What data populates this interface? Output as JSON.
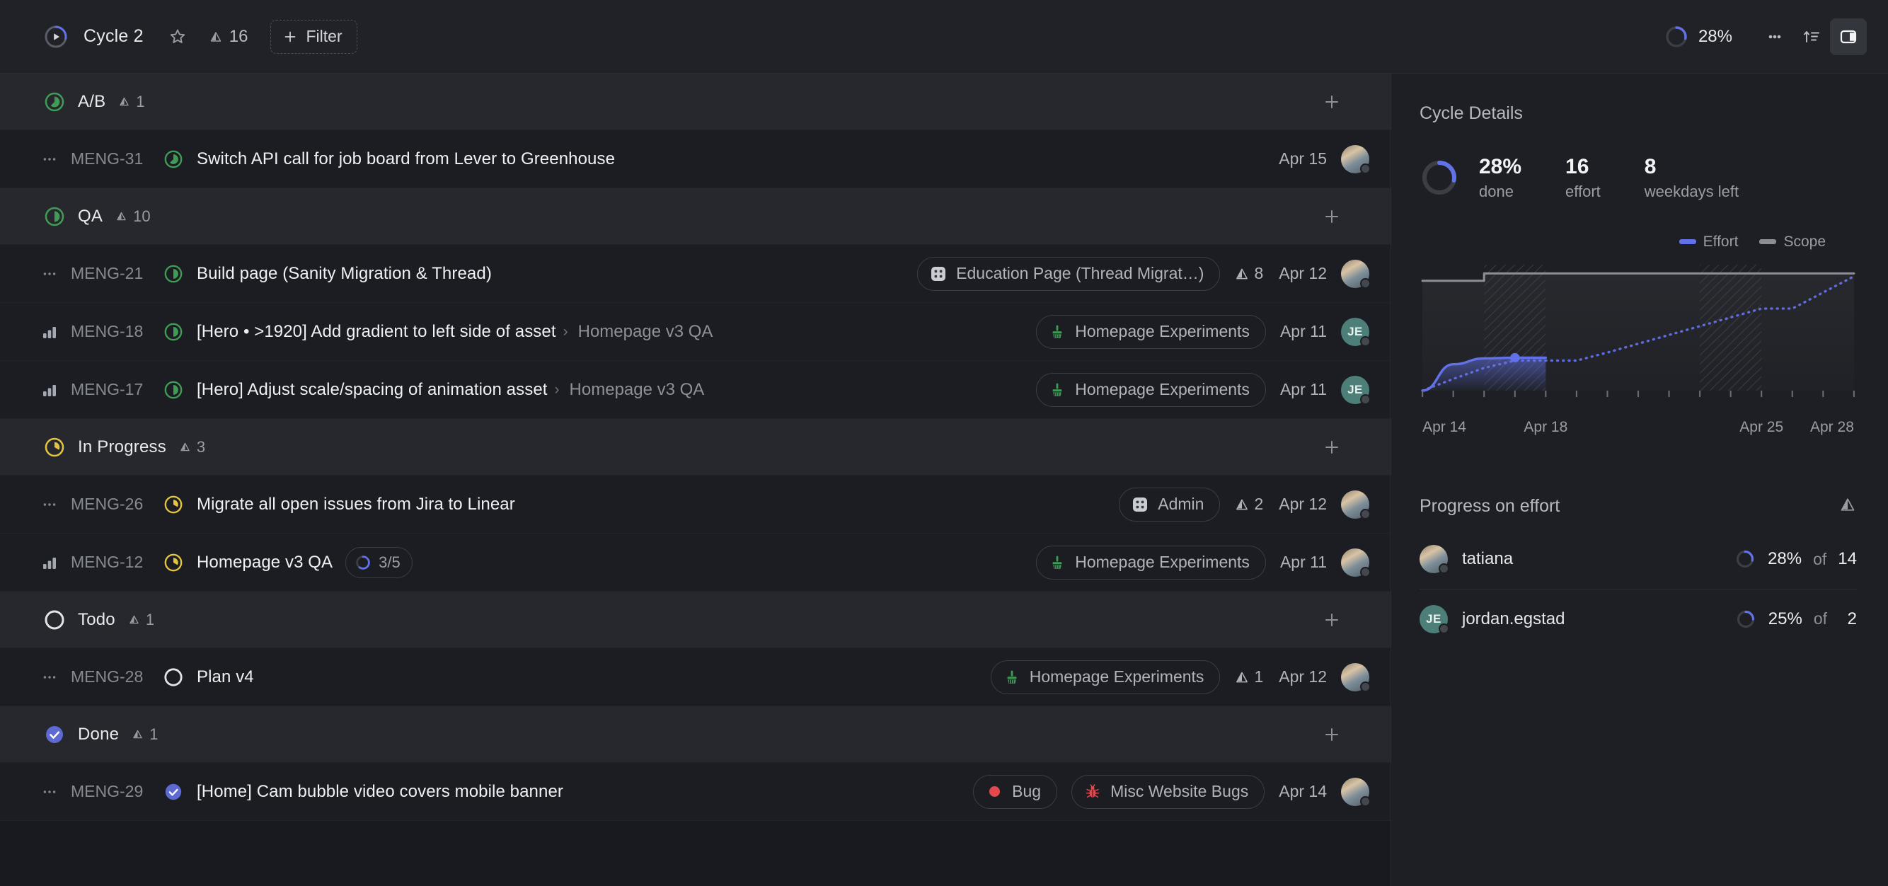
{
  "header": {
    "cycle_progress_pct": 28,
    "title": "Cycle 2",
    "star_icon": "star-icon",
    "estimate_icon": "estimate-triangle-icon",
    "estimate_total": "16",
    "filter_label": "Filter",
    "filter_icon": "plus-icon",
    "progress_label": "28%",
    "more_icon": "ellipsis-icon",
    "sort_icon": "sort-ascending-icon",
    "panel_icon": "sidebar-toggle-icon"
  },
  "accent": {
    "blue": "#6271e8",
    "green": "#3f9c54",
    "yellow": "#e3c53d",
    "done_purple": "#5e6ad2",
    "red": "#e5484d",
    "teal": "#4d7f78"
  },
  "groups": [
    {
      "name": "A/B",
      "status": "ab",
      "count": "1",
      "add_icon": "plus-icon",
      "issues": [
        {
          "priority_icon": "no-priority-icon",
          "id": "MENG-31",
          "status": "ab",
          "title": "Switch API call for job board from Lever to Greenhouse",
          "parent": "",
          "sub_progress": "",
          "labels": [],
          "project": null,
          "estimate": "",
          "date": "Apr 15",
          "avatar_type": "photo",
          "avatar_initials": ""
        }
      ]
    },
    {
      "name": "QA",
      "status": "qa",
      "count": "10",
      "add_icon": "plus-icon",
      "issues": [
        {
          "priority_icon": "no-priority-icon",
          "id": "MENG-21",
          "status": "qa",
          "title": "Build page (Sanity Migration & Thread)",
          "parent": "",
          "sub_progress": "",
          "labels": [],
          "project": {
            "name": "Education Page (Thread Migrat…)",
            "icon": "grid-project-icon",
            "icon_color": "#c9ccd3"
          },
          "estimate": "8",
          "date": "Apr 12",
          "avatar_type": "photo",
          "avatar_initials": ""
        },
        {
          "priority_icon": "priority-bars-icon",
          "id": "MENG-18",
          "status": "qa",
          "title": "[Hero • >1920] Add gradient to left side of asset",
          "parent": "Homepage v3 QA",
          "sub_progress": "",
          "labels": [],
          "project": {
            "name": "Homepage Experiments",
            "icon": "paintbrush-project-icon",
            "icon_color": "#3f9c54"
          },
          "estimate": "",
          "date": "Apr 11",
          "avatar_type": "initials",
          "avatar_initials": "JE"
        },
        {
          "priority_icon": "priority-bars-icon",
          "id": "MENG-17",
          "status": "qa",
          "title": "[Hero] Adjust scale/spacing of animation asset",
          "parent": "Homepage v3 QA",
          "sub_progress": "",
          "labels": [],
          "project": {
            "name": "Homepage Experiments",
            "icon": "paintbrush-project-icon",
            "icon_color": "#3f9c54"
          },
          "estimate": "",
          "date": "Apr 11",
          "avatar_type": "initials",
          "avatar_initials": "JE"
        }
      ]
    },
    {
      "name": "In Progress",
      "status": "inprogress",
      "count": "3",
      "add_icon": "plus-icon",
      "issues": [
        {
          "priority_icon": "no-priority-icon",
          "id": "MENG-26",
          "status": "inprogress",
          "title": "Migrate all open issues from Jira to Linear",
          "parent": "",
          "sub_progress": "",
          "labels": [],
          "project": {
            "name": "Admin",
            "icon": "grid-project-icon",
            "icon_color": "#c9ccd3"
          },
          "estimate": "2",
          "date": "Apr 12",
          "avatar_type": "photo",
          "avatar_initials": ""
        },
        {
          "priority_icon": "priority-bars-icon",
          "id": "MENG-12",
          "status": "inprogress",
          "title": "Homepage v3 QA",
          "parent": "",
          "sub_progress": "3/5",
          "labels": [],
          "project": {
            "name": "Homepage Experiments",
            "icon": "paintbrush-project-icon",
            "icon_color": "#3f9c54"
          },
          "estimate": "",
          "date": "Apr 11",
          "avatar_type": "photo",
          "avatar_initials": ""
        }
      ]
    },
    {
      "name": "Todo",
      "status": "todo",
      "count": "1",
      "add_icon": "plus-icon",
      "issues": [
        {
          "priority_icon": "no-priority-icon",
          "id": "MENG-28",
          "status": "todo",
          "title": "Plan v4",
          "parent": "",
          "sub_progress": "",
          "labels": [],
          "project": {
            "name": "Homepage Experiments",
            "icon": "paintbrush-project-icon",
            "icon_color": "#3f9c54"
          },
          "estimate": "1",
          "date": "Apr 12",
          "avatar_type": "photo",
          "avatar_initials": ""
        }
      ]
    },
    {
      "name": "Done",
      "status": "done",
      "count": "1",
      "add_icon": "plus-icon",
      "issues": [
        {
          "priority_icon": "no-priority-icon",
          "id": "MENG-29",
          "status": "done",
          "title": "[Home] Cam bubble video covers mobile banner",
          "parent": "",
          "sub_progress": "",
          "labels": [
            {
              "name": "Bug",
              "color": "#e5484d"
            }
          ],
          "project": {
            "name": "Misc Website Bugs",
            "icon": "bug-project-icon",
            "icon_color": "#e5484d"
          },
          "estimate": "",
          "date": "Apr 14",
          "avatar_type": "photo",
          "avatar_initials": ""
        }
      ]
    }
  ],
  "sidebar": {
    "title": "Cycle Details",
    "donut_pct": 28,
    "stats": [
      {
        "value": "28%",
        "label": "done"
      },
      {
        "value": "16",
        "label": "effort"
      },
      {
        "value": "8",
        "label": "weekdays left"
      }
    ],
    "progress_section": {
      "title": "Progress on effort",
      "icon": "estimate-triangle-icon",
      "rows": [
        {
          "avatar_type": "photo",
          "initials": "",
          "name": "tatiana",
          "pct": "28%",
          "pct_value": 28,
          "of_label": "of",
          "total": "14"
        },
        {
          "avatar_type": "initials",
          "initials": "JE",
          "name": "jordan.egstad",
          "pct": "25%",
          "pct_value": 25,
          "of_label": "of",
          "total": "2"
        }
      ]
    }
  },
  "chart_data": {
    "type": "area",
    "title": "",
    "xlabel": "",
    "ylabel": "",
    "legend": [
      {
        "name": "Effort",
        "color": "#6271e8"
      },
      {
        "name": "Scope",
        "color": "#8b8e96"
      }
    ],
    "legend_position": "top-right",
    "grid": false,
    "x": [
      "Apr 14",
      "Apr 15",
      "Apr 16",
      "Apr 17",
      "Apr 18",
      "Apr 19",
      "Apr 20",
      "Apr 21",
      "Apr 22",
      "Apr 23",
      "Apr 24",
      "Apr 25",
      "Apr 26",
      "Apr 27",
      "Apr 28"
    ],
    "tick_labels": [
      "Apr 14",
      "Apr 18",
      "Apr 25",
      "Apr 28"
    ],
    "ylim": [
      0,
      17
    ],
    "series": [
      {
        "name": "Scope",
        "style": "step-line",
        "color": "#8b8e96",
        "values": [
          15,
          15,
          16,
          16,
          16,
          16,
          16,
          16,
          16,
          16,
          16,
          16,
          16,
          16,
          16
        ]
      },
      {
        "name": "Effort",
        "style": "area-line",
        "color": "#6271e8",
        "values": [
          0,
          3.6,
          4.4,
          4.5,
          4.5,
          null,
          null,
          null,
          null,
          null,
          null,
          null,
          null,
          null,
          null
        ]
      },
      {
        "name": "Ideal",
        "style": "dotted",
        "color": "#6271e8",
        "values": [
          0,
          1.6,
          3.1,
          4.1,
          4.1,
          4.1,
          5.2,
          6.4,
          7.6,
          8.8,
          10.0,
          11.2,
          11.2,
          13.4,
          15.6
        ]
      }
    ],
    "marker": {
      "x": "Apr 17",
      "y": 4.5,
      "color": "#6271e8"
    },
    "weekend_bands": [
      {
        "from": "Apr 16",
        "to": "Apr 18"
      },
      {
        "from": "Apr 23",
        "to": "Apr 25"
      }
    ]
  }
}
